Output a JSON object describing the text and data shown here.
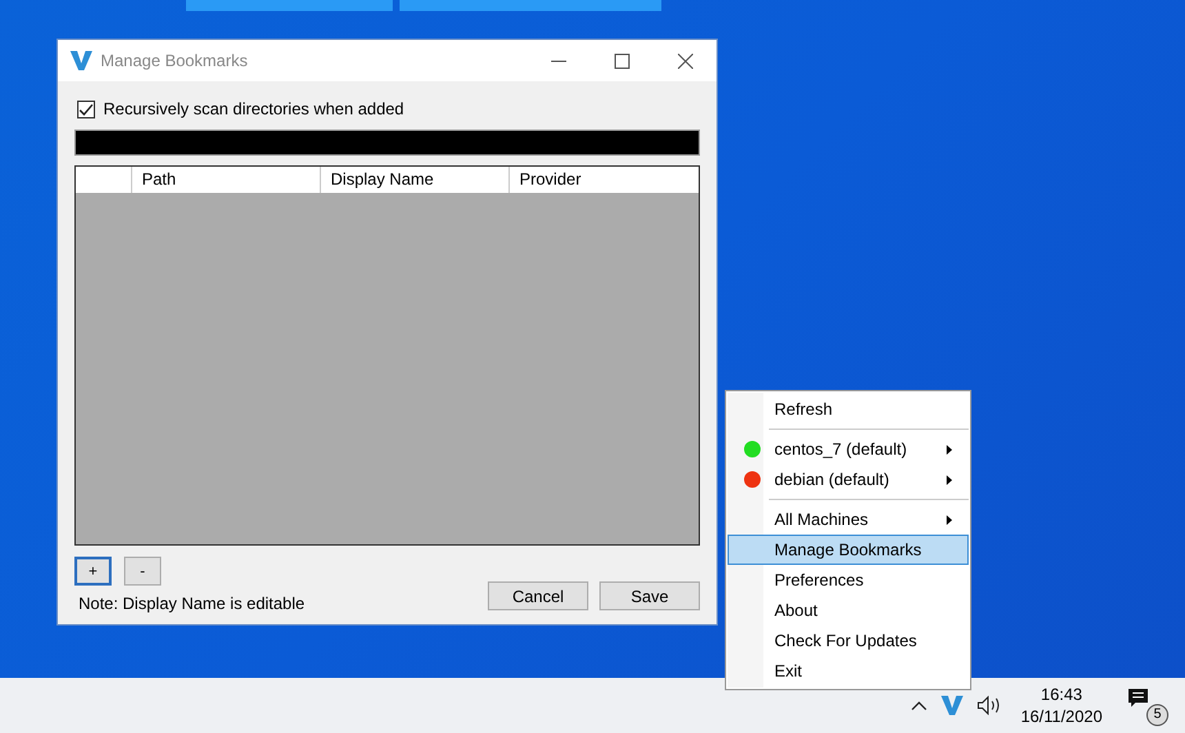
{
  "dialog": {
    "title": "Manage Bookmarks",
    "recursive_checkbox": {
      "label": "Recursively scan directories when added",
      "checked": true
    },
    "table": {
      "columns": [
        "Path",
        "Display Name",
        "Provider"
      ]
    },
    "add_button": "+",
    "remove_button": "-",
    "note": "Note: Display Name is editable",
    "cancel_button": "Cancel",
    "save_button": "Save"
  },
  "context_menu": [
    {
      "kind": "item",
      "label": "Refresh",
      "selected": false,
      "submenu": false
    },
    {
      "kind": "separator"
    },
    {
      "kind": "machine",
      "label": "centos_7 (default)",
      "color": "#22dd22",
      "selected": false,
      "submenu": true
    },
    {
      "kind": "machine",
      "label": "debian (default)",
      "color": "#ee3311",
      "selected": false,
      "submenu": true
    },
    {
      "kind": "separator"
    },
    {
      "kind": "item",
      "label": "All Machines",
      "selected": false,
      "submenu": true
    },
    {
      "kind": "item",
      "label": "Manage Bookmarks",
      "selected": true,
      "submenu": false
    },
    {
      "kind": "item",
      "label": "Preferences",
      "selected": false,
      "submenu": false
    },
    {
      "kind": "item",
      "label": "About",
      "selected": false,
      "submenu": false
    },
    {
      "kind": "item",
      "label": "Check For Updates",
      "selected": false,
      "submenu": false
    },
    {
      "kind": "item",
      "label": "Exit",
      "selected": false,
      "submenu": false
    }
  ],
  "taskbar": {
    "time": "16:43",
    "date": "16/11/2020",
    "notification_count": "5"
  }
}
